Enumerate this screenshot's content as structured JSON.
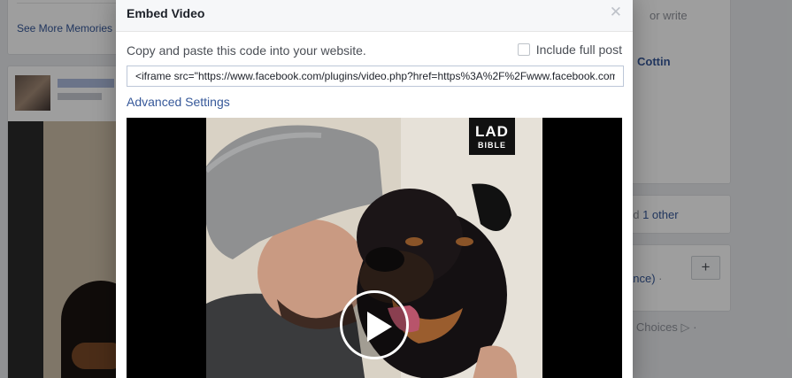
{
  "background": {
    "memories_link": "See More Memories",
    "right_rail": {
      "write_text": "or write",
      "friend_name": "Cottin",
      "likes_prefix": "nd",
      "likes_link": "1 other",
      "language_fragment": "ance)",
      "language_separator": "·",
      "add_button": "+",
      "ad_choices": "d Choices",
      "ad_choices_separator": "·"
    }
  },
  "modal": {
    "title": "Embed Video",
    "close_icon": "close-icon",
    "instructions": "Copy and paste this code into your website.",
    "include_full_post_label": "Include full post",
    "include_full_post_checked": false,
    "embed_code": "<iframe src=\"https://www.facebook.com/plugins/video.php?href=https%3A%2F%2Fwww.facebook.com",
    "advanced_settings_link": "Advanced Settings",
    "video": {
      "badge_line1": "LAD",
      "badge_line2": "BIBLE",
      "play_icon": "play-icon"
    }
  },
  "colors": {
    "link": "#365899",
    "header_bg": "#f6f7f9",
    "page_bg": "#e9ebee"
  }
}
